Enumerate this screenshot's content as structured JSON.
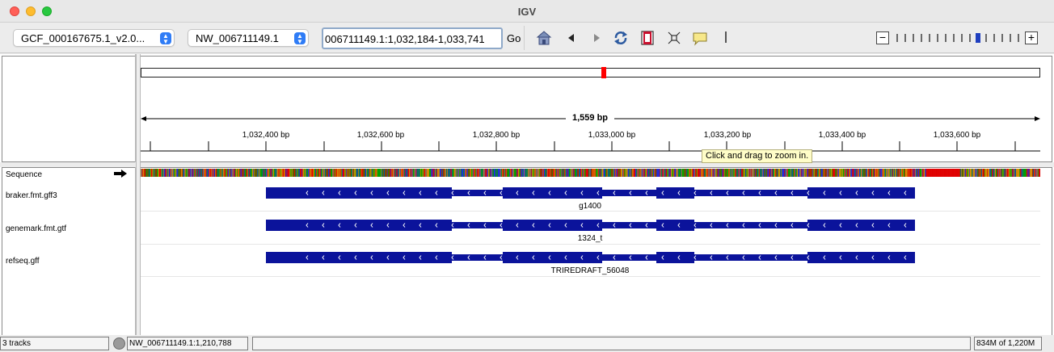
{
  "window": {
    "title": "IGV"
  },
  "toolbar": {
    "genome": "GCF_000167675.1_v2.0...",
    "chromosome": "NW_006711149.1",
    "locus": "006711149.1:1,032,184-1,033,741",
    "go_label": "Go",
    "icons": [
      "home-icon",
      "back-icon",
      "forward-icon",
      "refresh-icon",
      "roi-icon",
      "fit-icon",
      "popup-info-icon"
    ]
  },
  "ruler": {
    "span_label": "1,559 bp",
    "ticks": [
      "1,032,400 bp",
      "1,032,600 bp",
      "1,032,800 bp",
      "1,033,000 bp",
      "1,033,200 bp",
      "1,033,400 bp",
      "1,033,600 bp"
    ]
  },
  "tooltip": "Click and drag to zoom in.",
  "tracks": [
    {
      "name": "Sequence"
    },
    {
      "name": "braker.fmt.gff3",
      "feature_label": "g1400"
    },
    {
      "name": "genemark.fmt.gtf",
      "feature_label": "1324_t"
    },
    {
      "name": "refseq.gff",
      "feature_label": "TRIREDRAFT_56048"
    }
  ],
  "status": {
    "tracks": "3 tracks",
    "position": "NW_006711149.1:1,210,788",
    "memory": "834M of 1,220M"
  },
  "colors": {
    "feature": "#0b139b",
    "seq_A": "#00a000",
    "seq_C": "#1f2fd8",
    "seq_G": "#d38b00",
    "seq_T": "#e00000",
    "ideogram_marker": "#ff0000"
  }
}
